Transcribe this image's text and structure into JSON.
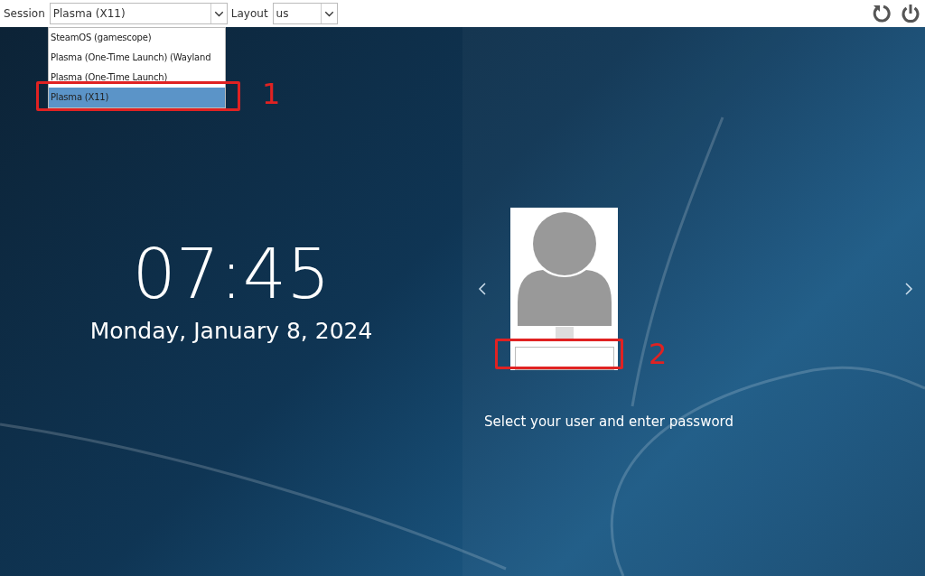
{
  "top_bar": {
    "session_label": "Session",
    "session_value": "Plasma (X11)",
    "layout_label": "Layout",
    "layout_value": "us"
  },
  "session_menu": {
    "items": [
      {
        "label": "SteamOS (gamescope)",
        "selected": false
      },
      {
        "label": "Plasma (One-Time Launch) (Wayland",
        "selected": false
      },
      {
        "label": "Plasma (One-Time Launch)",
        "selected": false
      },
      {
        "label": "Plasma (X11)",
        "selected": true
      }
    ]
  },
  "clock": {
    "time": "07:45",
    "date": "Monday, January 8, 2024"
  },
  "prompt": "Select your user and enter password",
  "annotations": [
    {
      "label": "1"
    },
    {
      "label": "2"
    }
  ]
}
